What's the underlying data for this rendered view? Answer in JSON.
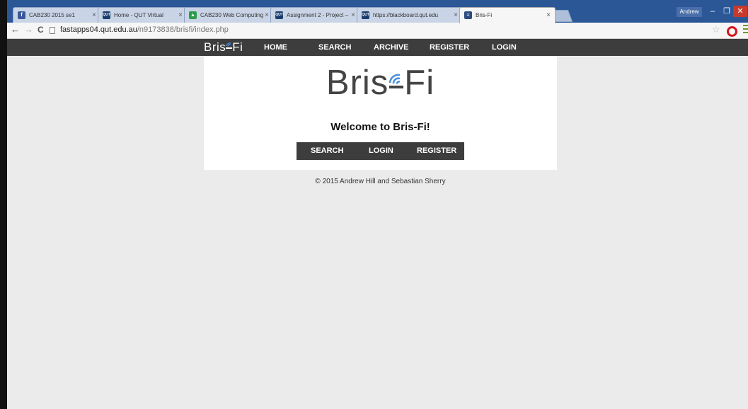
{
  "browser": {
    "tabs": [
      {
        "title": "CAB230 2015 se1",
        "favicon": "facebook-icon",
        "favicon_color": "#3b5998",
        "favicon_glyph": "f"
      },
      {
        "title": "Home - QUT Virtual",
        "favicon": "qut-icon",
        "favicon_color": "#1a3d6d",
        "favicon_glyph": "QUT"
      },
      {
        "title": "CAB230 Web Computing",
        "favicon": "drive-icon",
        "favicon_color": "#2a9d4a",
        "favicon_glyph": "▲"
      },
      {
        "title": "Assignment 2 - Project –",
        "favicon": "qut-icon",
        "favicon_color": "#1a3d6d",
        "favicon_glyph": "QUT"
      },
      {
        "title": "https://blackboard.qut.edu",
        "favicon": "qut-icon",
        "favicon_color": "#1a3d6d",
        "favicon_glyph": "QUT"
      },
      {
        "title": "Bris-Fi",
        "favicon": "brisfi-icon",
        "favicon_color": "#2b4c7e",
        "favicon_glyph": "≈"
      }
    ],
    "tab_close": "×",
    "user": "Andrew",
    "window_controls": {
      "minimize": "–",
      "maximize": "❐",
      "close": "✕"
    },
    "nav": {
      "back": "←",
      "forward": "→",
      "reload": "C"
    },
    "address": {
      "host": "fastapps04.qut.edu.au",
      "path": "/n9173838/brisfi/index.php"
    },
    "star": "☆"
  },
  "site": {
    "bar_logo": "Bris",
    "bar_logo_tail": "Fi",
    "nav": [
      "HOME",
      "SEARCH",
      "ARCHIVE",
      "REGISTER",
      "LOGIN"
    ],
    "logo_head": "Bris",
    "logo_tail": "Fi",
    "welcome": "Welcome to Bris-Fi!",
    "buttons": [
      "SEARCH",
      "LOGIN",
      "REGISTER"
    ],
    "footer": "© 2015 Andrew Hill and Sebastian Sherry"
  },
  "colors": {
    "titlebar": "#2b5797",
    "navbar": "#3d3d3d",
    "page_bg": "#ebebeb",
    "wifi_accent": "#4a90d9"
  }
}
